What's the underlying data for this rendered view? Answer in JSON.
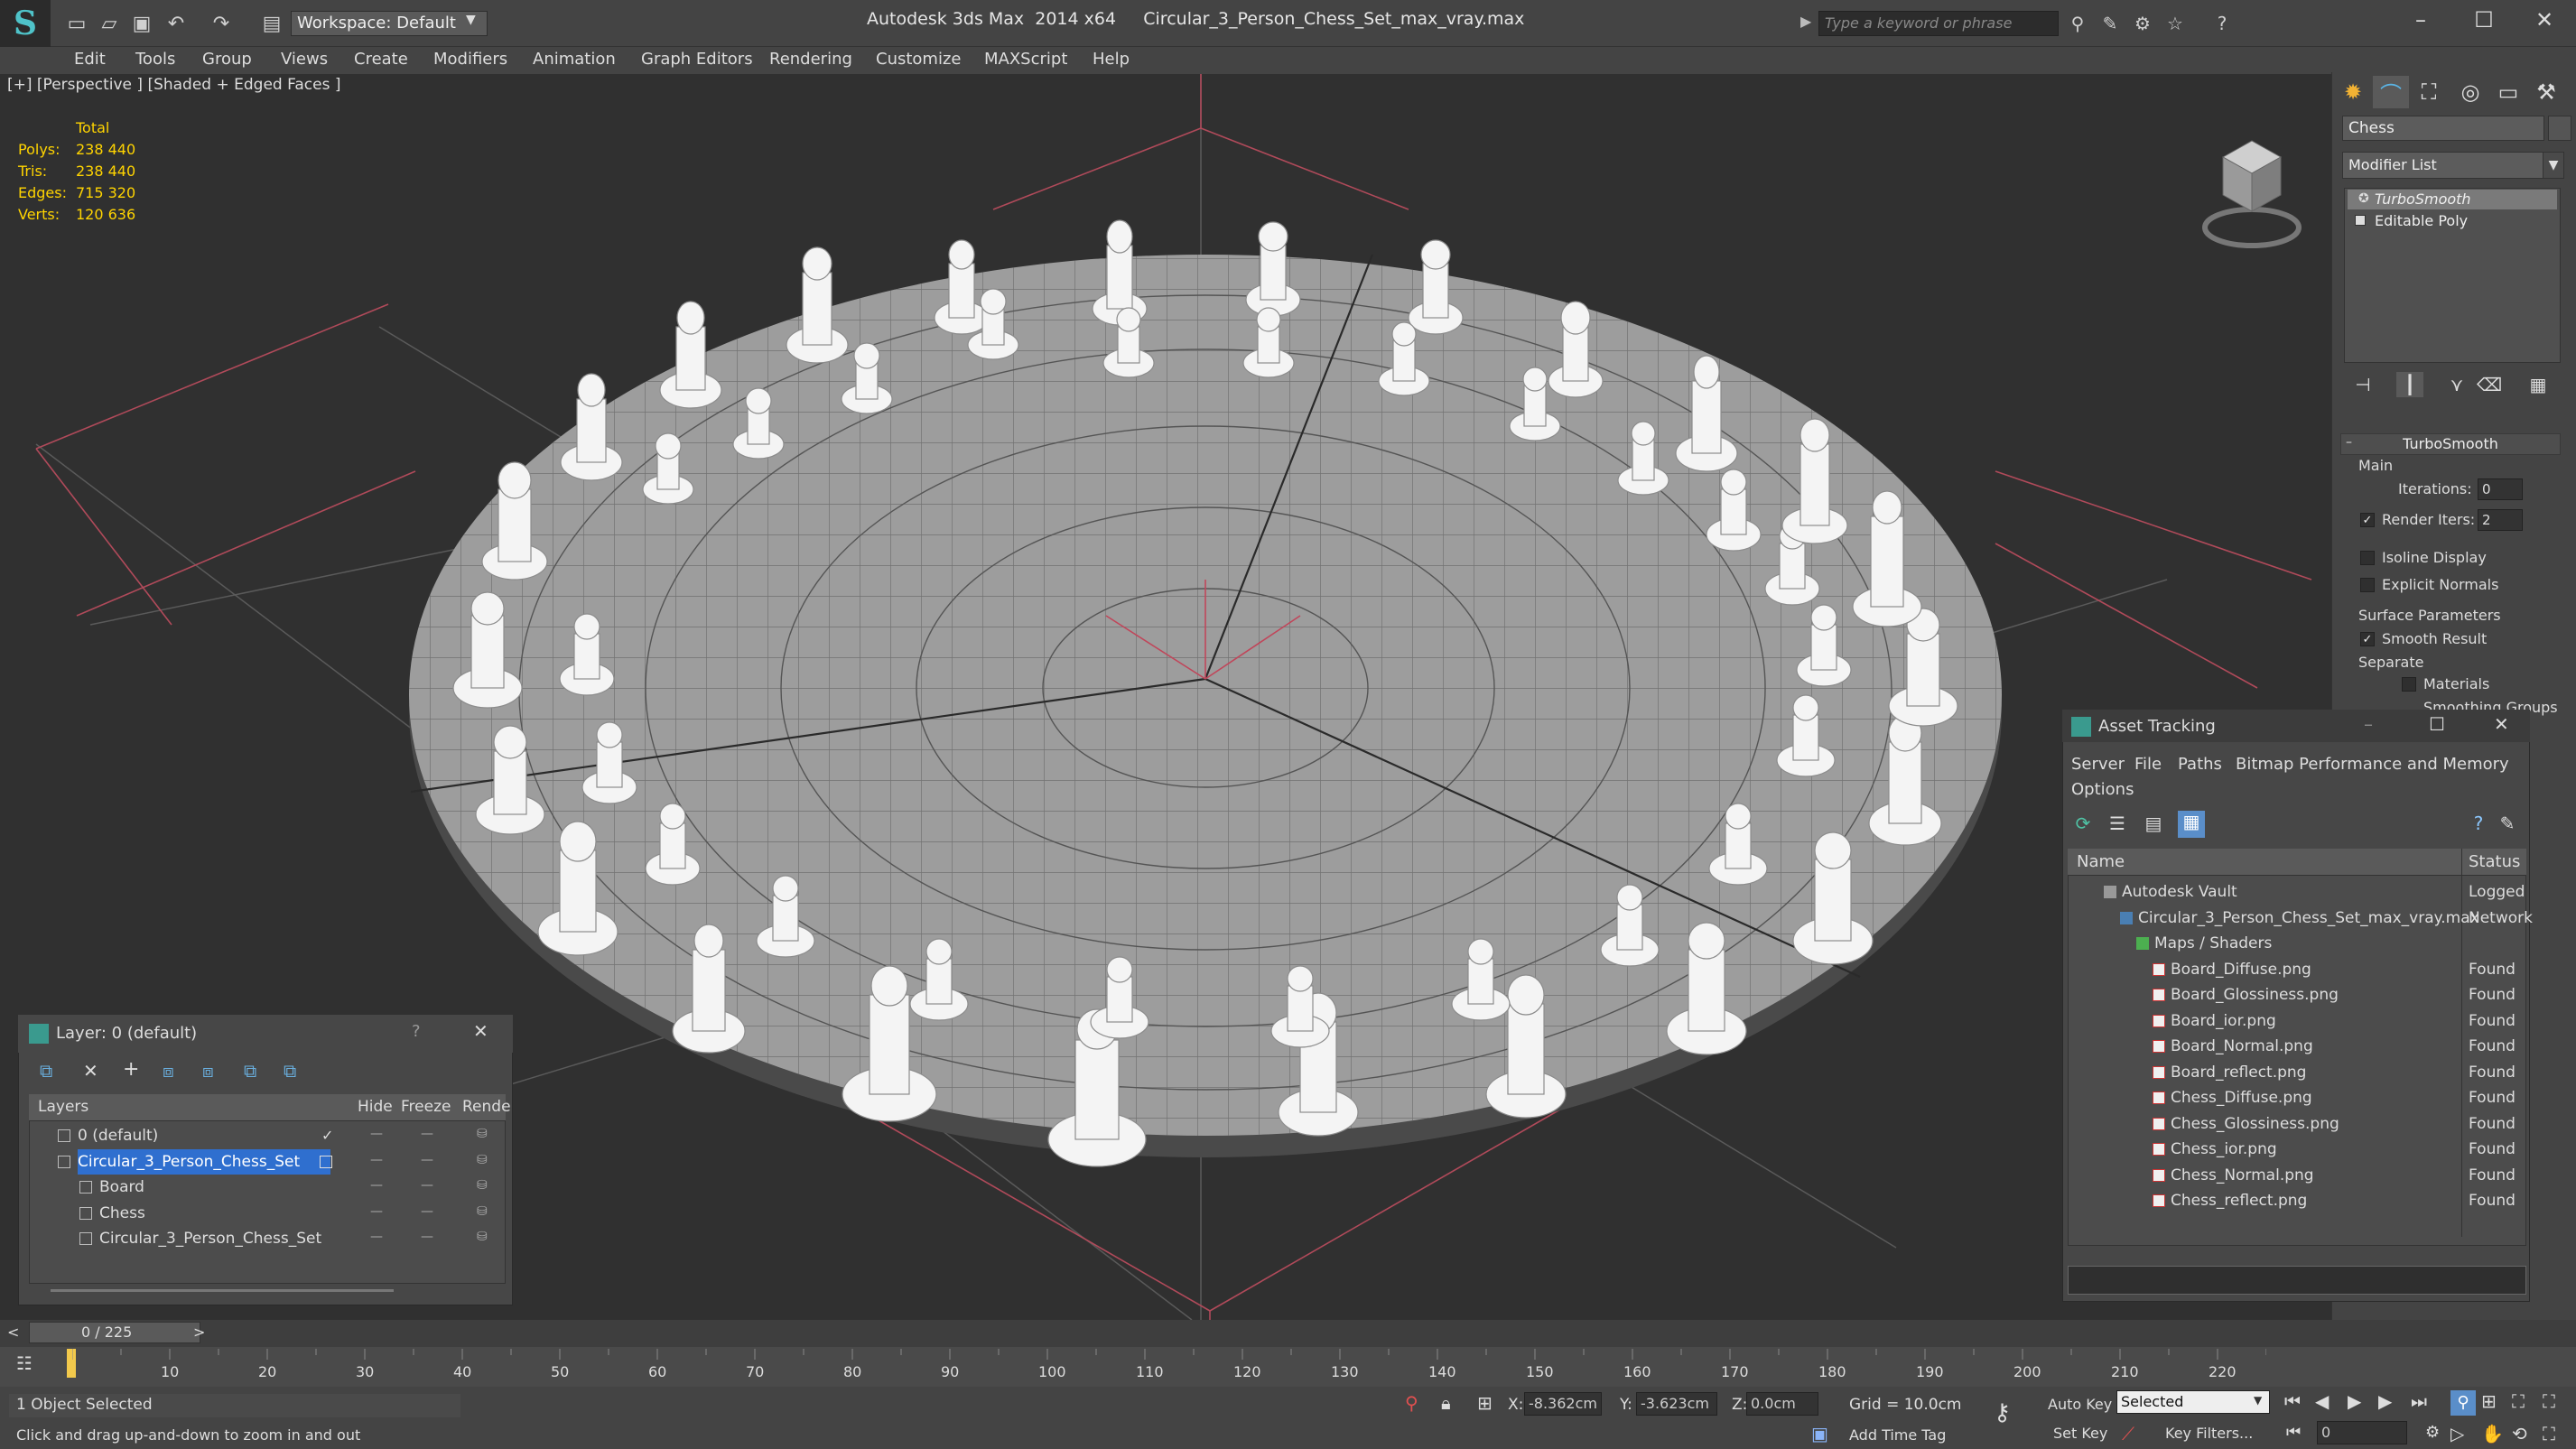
{
  "titlebar": {
    "workspace": "Workspace: Default",
    "title": "Autodesk 3ds Max  2014 x64     Circular_3_Person_Chess_Set_max_vray.max",
    "search_placeholder": "Type a keyword or phrase"
  },
  "menu": [
    "Edit",
    "Tools",
    "Group",
    "Views",
    "Create",
    "Modifiers",
    "Animation",
    "Graph Editors",
    "Rendering",
    "Customize",
    "MAXScript",
    "Help"
  ],
  "viewport": {
    "label": "[+] [Perspective ] [Shaded + Edged Faces ]",
    "stats_header": "Total",
    "stats": [
      {
        "label": "Polys:",
        "value": "238 440"
      },
      {
        "label": "Tris:",
        "value": "238 440"
      },
      {
        "label": "Edges:",
        "value": "715 320"
      },
      {
        "label": "Verts:",
        "value": "120 636"
      }
    ]
  },
  "command_panel": {
    "object_name": "Chess",
    "modifier_list": "Modifier List",
    "stack": [
      "TurboSmooth",
      "Editable Poly"
    ],
    "rollout_title": "TurboSmooth",
    "main_label": "Main",
    "iterations_label": "Iterations:",
    "iterations_value": "0",
    "render_iters_label": "Render Iters:",
    "render_iters_value": "2",
    "isoline": "Isoline Display",
    "explicit_normals": "Explicit Normals",
    "surface_params": "Surface Parameters",
    "smooth_result": "Smooth Result",
    "separate": "Separate",
    "materials": "Materials",
    "smoothing_groups": "Smoothing Groups"
  },
  "asset_tracking": {
    "title": "Asset Tracking",
    "menu": [
      "Server",
      "File",
      "Paths",
      "Bitmap Performance and Memory"
    ],
    "options": "Options",
    "col_name": "Name",
    "col_status": "Status",
    "rows": [
      {
        "name": "Autodesk Vault",
        "status": "Logged",
        "indent": 0
      },
      {
        "name": "Circular_3_Person_Chess_Set_max_vray.max",
        "status": "Network",
        "indent": 1
      },
      {
        "name": "Maps / Shaders",
        "status": "",
        "indent": 2
      },
      {
        "name": "Board_Diffuse.png",
        "status": "Found",
        "indent": 3
      },
      {
        "name": "Board_Glossiness.png",
        "status": "Found",
        "indent": 3
      },
      {
        "name": "Board_ior.png",
        "status": "Found",
        "indent": 3
      },
      {
        "name": "Board_Normal.png",
        "status": "Found",
        "indent": 3
      },
      {
        "name": "Board_reflect.png",
        "status": "Found",
        "indent": 3
      },
      {
        "name": "Chess_Diffuse.png",
        "status": "Found",
        "indent": 3
      },
      {
        "name": "Chess_Glossiness.png",
        "status": "Found",
        "indent": 3
      },
      {
        "name": "Chess_ior.png",
        "status": "Found",
        "indent": 3
      },
      {
        "name": "Chess_Normal.png",
        "status": "Found",
        "indent": 3
      },
      {
        "name": "Chess_reflect.png",
        "status": "Found",
        "indent": 3
      }
    ]
  },
  "layer_manager": {
    "title": "Layer: 0 (default)",
    "help": "?",
    "col_layers": "Layers",
    "col_hide": "Hide",
    "col_freeze": "Freeze",
    "col_render": "Rende",
    "rows": [
      {
        "name": "0 (default)",
        "indent": 0,
        "selected": false
      },
      {
        "name": "Circular_3_Person_Chess_Set",
        "indent": 0,
        "selected": true
      },
      {
        "name": "Board",
        "indent": 1,
        "selected": false
      },
      {
        "name": "Chess",
        "indent": 1,
        "selected": false
      },
      {
        "name": "Circular_3_Person_Chess_Set",
        "indent": 1,
        "selected": false
      }
    ]
  },
  "timeline": {
    "frame": "0 / 225",
    "ticks": [
      "10",
      "20",
      "30",
      "40",
      "50",
      "60",
      "70",
      "80",
      "90",
      "100",
      "110",
      "120",
      "130",
      "140",
      "150",
      "160",
      "170",
      "180",
      "190",
      "200",
      "210",
      "220"
    ]
  },
  "status": {
    "selected": "1 Object Selected",
    "hint": "Click and drag up-and-down to zoom in and out",
    "x_label": "X:",
    "x_value": "-8.362cm",
    "y_label": "Y:",
    "y_value": "-3.623cm",
    "z_label": "Z:",
    "z_value": "0.0cm",
    "grid": "Grid = 10.0cm",
    "add_time_tag": "Add Time Tag",
    "auto_key": "Auto Key",
    "selected_mode": "Selected",
    "set_key": "Set Key",
    "key_filters": "Key Filters...",
    "frame_value": "0"
  }
}
